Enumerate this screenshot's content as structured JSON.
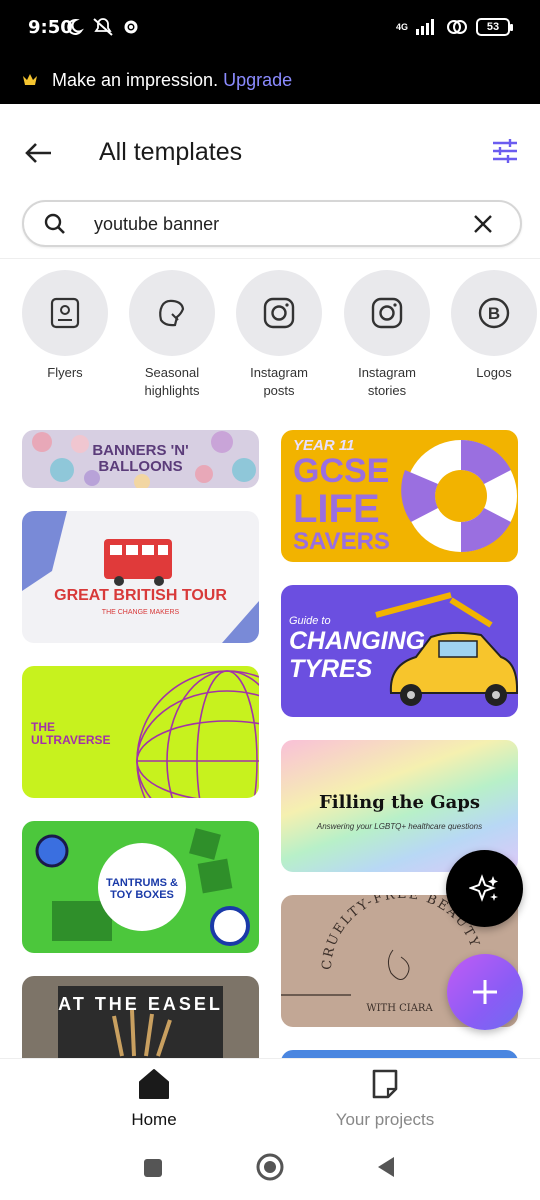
{
  "status": {
    "time": "9:50",
    "battery": "53",
    "network": "4G"
  },
  "banner": {
    "text": "Make an impression.",
    "link": "Upgrade"
  },
  "header": {
    "title": "All templates"
  },
  "search": {
    "value": "youtube banner"
  },
  "categories": [
    {
      "label": "Flyers",
      "icon": "flyer-icon"
    },
    {
      "label": "Seasonal highlights",
      "icon": "seasonal-icon"
    },
    {
      "label": "Instagram posts",
      "icon": "instagram-icon"
    },
    {
      "label": "Instagram stories",
      "icon": "instagram-icon"
    },
    {
      "label": "Logos",
      "icon": "logo-b-icon"
    }
  ],
  "templates": {
    "balloons": {
      "line1": "BANNERS 'N'",
      "line2": "BALLOONS"
    },
    "tour": {
      "title": "GREAT BRITISH TOUR",
      "subtitle": "THE CHANGE MAKERS"
    },
    "ultraverse": {
      "line1": "THE",
      "line2": "ULTRAVERSE"
    },
    "tantrums": {
      "line1": "TANTRUMS &",
      "line2": "TOY BOXES"
    },
    "easel": {
      "text": "AT THE EASEL"
    },
    "gcse": {
      "line1": "YEAR 11",
      "line2": "GCSE",
      "line3": "LIFE",
      "line4": "SAVERS"
    },
    "tyres": {
      "line1": "Guide to",
      "line2": "CHANGING",
      "line3": "TYRES"
    },
    "gaps": {
      "title": "Filling the Gaps",
      "subtitle": "Answering your LGBTQ+ healthcare questions"
    },
    "cruelty": {
      "arc": "CRUELTY-FREE BEAUTY",
      "bottom": "WITH CIARA"
    }
  },
  "nav": {
    "home": "Home",
    "projects": "Your projects"
  },
  "colors": {
    "accent": "#6b5cf0",
    "upgrade": "#8b8bff"
  }
}
